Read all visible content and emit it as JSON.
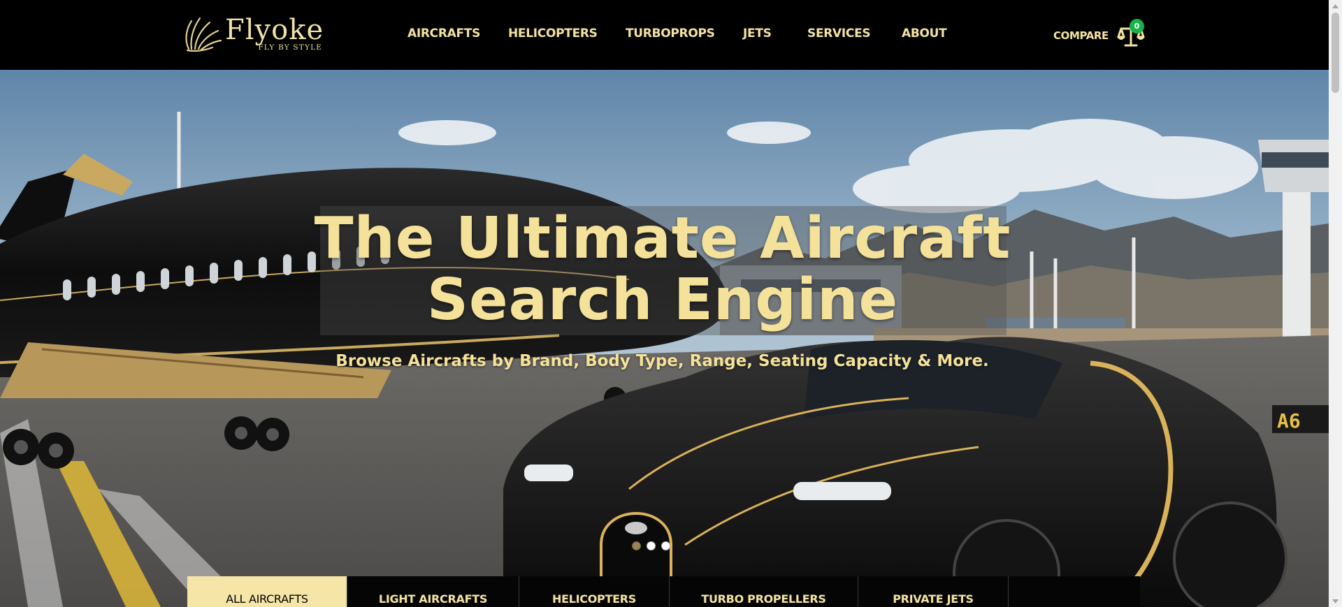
{
  "brand": {
    "name": "Flyoke",
    "tagline": "FLY BY STYLE",
    "accent_color": "#f3e3a3",
    "logo_icon": "wing-logo-icon"
  },
  "nav": {
    "items": [
      {
        "label": "AIRCRAFTS"
      },
      {
        "label": "HELICOPTERS"
      },
      {
        "label": "TURBOPROPS"
      },
      {
        "label": "JETS"
      },
      {
        "label": "SERVICES"
      },
      {
        "label": "ABOUT"
      }
    ]
  },
  "compare": {
    "label": "COMPARE",
    "icon": "balance-scale-icon",
    "count": "0",
    "badge_color": "#16b34a"
  },
  "hero": {
    "headline_line1": "The Ultimate Aircraft",
    "headline_line2": "Search Engine",
    "subheadline": "Browse Aircrafts by Brand, Body Type, Range, Seating Capacity & More.",
    "background": "private jet and black-gold supercar on airport tarmac",
    "slider": {
      "total": 3,
      "active_index": 0
    }
  },
  "tabs": {
    "items": [
      {
        "label": "ALL AIRCRAFTS",
        "active": true
      },
      {
        "label": "LIGHT AIRCRAFTS",
        "active": false
      },
      {
        "label": "HELICOPTERS",
        "active": false
      },
      {
        "label": "TURBO PROPELLERS",
        "active": false
      },
      {
        "label": "PRIVATE JETS",
        "active": false
      }
    ]
  }
}
